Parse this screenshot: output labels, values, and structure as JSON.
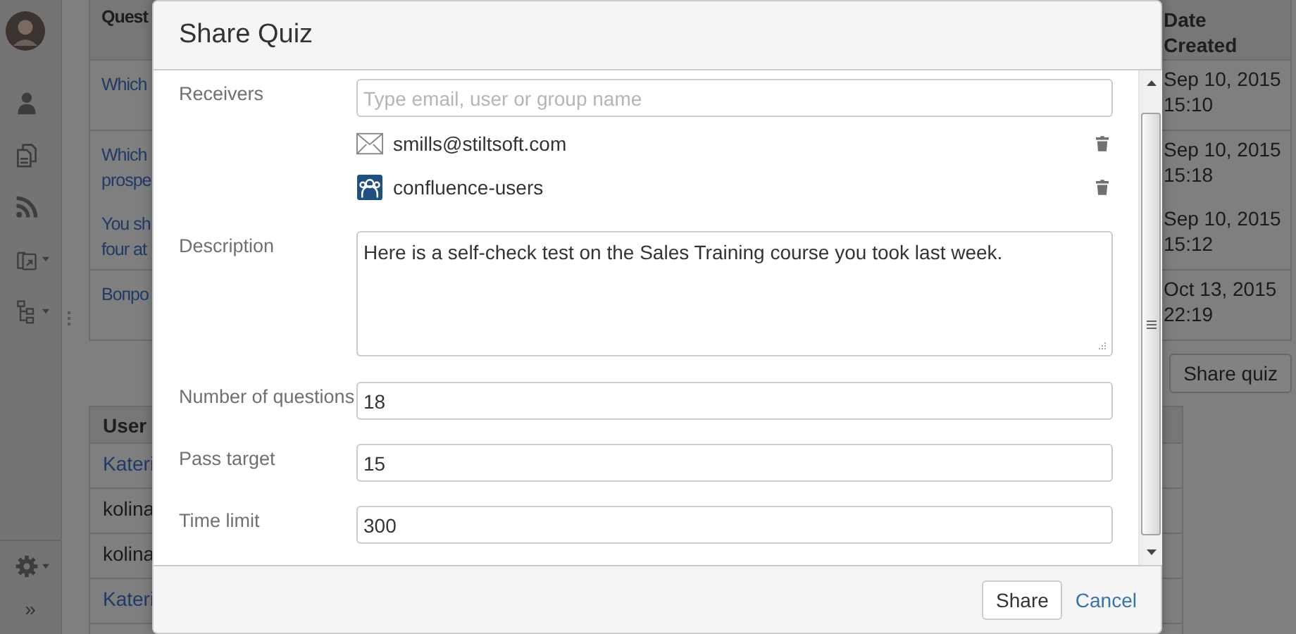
{
  "sidebar": {
    "items": [
      {
        "kind": "person"
      },
      {
        "kind": "pages"
      },
      {
        "kind": "feed"
      },
      {
        "kind": "export",
        "caret": true
      },
      {
        "kind": "tree",
        "caret": true
      }
    ],
    "settings": {
      "caret": true
    },
    "collapse": "»"
  },
  "questions_table": {
    "columns": [
      "Quest",
      "Date Created"
    ],
    "rows": [
      {
        "entries": [
          {
            "question": [
              "Which"
            ],
            "date": "Sep 10, 2015 15:10"
          }
        ]
      },
      {
        "entries": [
          {
            "question": [
              "Which",
              "prospe"
            ],
            "date": "Sep 10, 2015 15:18"
          },
          {
            "question": [
              "You sh",
              "four at"
            ],
            "date": "Sep 10, 2015 15:12"
          }
        ]
      },
      {
        "entries": [
          {
            "question": [
              "Вопро"
            ],
            "date": "Oct 13, 2015 22:19"
          }
        ]
      }
    ]
  },
  "share_button": "Share quiz",
  "users_table": {
    "columns": [
      "User"
    ],
    "rows": [
      {
        "user": "Kateri",
        "link": true
      },
      {
        "user": "kolina",
        "link": false
      },
      {
        "user": "kolina",
        "link": false
      },
      {
        "user": "Kateri",
        "link": true
      }
    ]
  },
  "dialog": {
    "title": "Share Quiz",
    "receivers": {
      "label": "Receivers",
      "placeholder": "Type email, user or group name",
      "items": [
        {
          "kind": "email",
          "name": "smills@stiltsoft.com"
        },
        {
          "kind": "group",
          "name": "confluence-users"
        }
      ]
    },
    "fields": [
      {
        "kind": "textarea",
        "label": "Description",
        "value": "Here is a self-check test on the Sales Training course you took last week."
      },
      {
        "kind": "input",
        "label": "Number of questions",
        "value": "18"
      },
      {
        "kind": "input",
        "label": "Pass target",
        "value": "15"
      },
      {
        "kind": "input",
        "label": "Time limit",
        "value": "300"
      }
    ],
    "submit": "Share",
    "cancel": "Cancel"
  }
}
